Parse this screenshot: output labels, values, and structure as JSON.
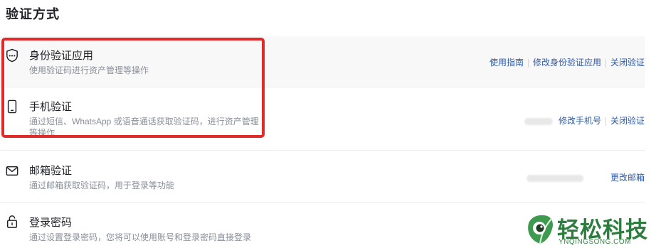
{
  "page": {
    "title": "验证方式"
  },
  "methods": [
    {
      "icon": "shield-icon",
      "title": "身份验证应用",
      "desc": "使用验证码进行资产管理等操作",
      "actions": [
        "使用指南",
        "修改身份验证应用",
        "关闭验证"
      ]
    },
    {
      "icon": "phone-icon",
      "title": "手机验证",
      "desc": "通过短信、WhatsApp 或语音通话获取验证码，进行资产管理等操作",
      "masked_value": true,
      "actions": [
        "修改手机号",
        "关闭验证"
      ]
    },
    {
      "icon": "mail-icon",
      "title": "邮箱验证",
      "desc": "通过邮箱获取验证码，用于登录等功能",
      "masked_value": true,
      "actions": [
        "更改邮箱"
      ]
    },
    {
      "icon": "lock-icon",
      "title": "登录密码",
      "desc": "通过设置登录密码，您将可以使用账号和登录密码直接登录",
      "actions": []
    }
  ],
  "highlight": {
    "color": "#e12a2a"
  },
  "watermark": {
    "title": "轻松科技",
    "url": "YNQINGSONG.COM",
    "color": "#2c7d3e"
  },
  "colors": {
    "link": "#2f5aa8",
    "muted": "#8a8f99",
    "row_shade": "#f8f8f8"
  }
}
